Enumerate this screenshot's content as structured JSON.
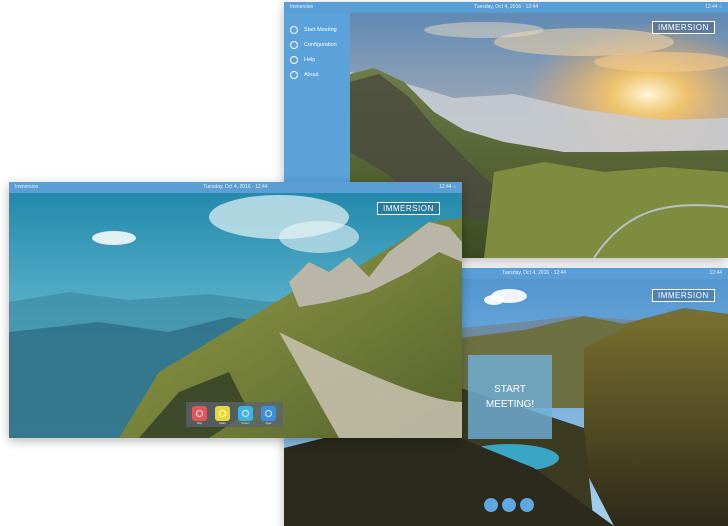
{
  "brand": {
    "logo": "IMMERSION"
  },
  "window_top": {
    "title_left": "Immersion",
    "title_center": "Tuesday, Oct 4, 2016 · 12:44",
    "title_right": "12:44 ○",
    "menu": [
      {
        "icon": "play-circle-icon",
        "label": "Start Meeting"
      },
      {
        "icon": "wrench-icon",
        "label": "Configuration"
      },
      {
        "icon": "help-icon",
        "label": "Help"
      },
      {
        "icon": "info-icon",
        "label": "About"
      }
    ]
  },
  "window_left": {
    "title_left": "Immersion",
    "title_center": "Tuesday, Oct 4, 2016 · 12:44",
    "title_right": "12:44 ○",
    "dock": [
      {
        "icon": "stop-icon",
        "label": "Stop",
        "color": "#e2555a"
      },
      {
        "icon": "share-icon",
        "label": "Share",
        "color": "#e6d83a"
      },
      {
        "icon": "screen-icon",
        "label": "Screen",
        "color": "#3fb2e6"
      },
      {
        "icon": "apps-icon",
        "label": "Apps",
        "color": "#3a8fe0"
      }
    ]
  },
  "window_right": {
    "title_center": "Tuesday, Oct 4, 2016 · 12:44",
    "title_right": "12:44",
    "start_tile": [
      "START",
      "MEETING!"
    ],
    "dots": 3
  }
}
